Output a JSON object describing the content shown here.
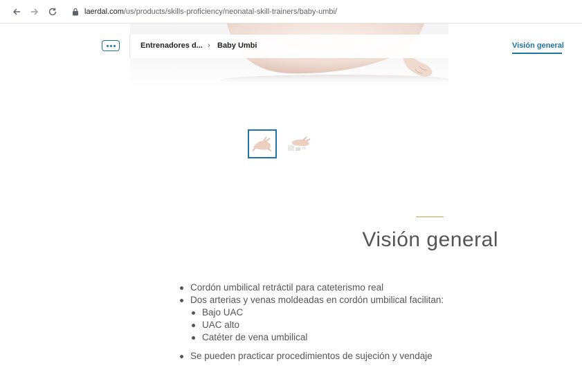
{
  "browser": {
    "url_host": "laerdal.com",
    "url_path": "/us/products/skills-proficiency/neonatal-skill-trainers/baby-umbi/"
  },
  "subnav": {
    "breadcrumb_1": "Entrenadores d...",
    "breadcrumb_sep": "›",
    "breadcrumb_2": "Baby Umbi",
    "overview_link": "Visión general"
  },
  "thumbnails": [
    {
      "name": "thumbnail-1",
      "selected": true
    },
    {
      "name": "thumbnail-2",
      "selected": false
    }
  ],
  "overview": {
    "title": "Visión general",
    "bullets": [
      "Cordón umbilical retráctil para cateterismo real",
      "Dos arterias y venas moldeadas en cordón umbilical facilitan:"
    ],
    "sub_bullets": [
      "Bajo UAC",
      "UAC alto",
      "Catéter de vena umbilical"
    ],
    "bullet_after": "Se pueden practicar procedimientos de sujeción y vendaje"
  },
  "colors": {
    "accent_blue": "#1f74a6",
    "accent_gold": "#c9a24a"
  },
  "icons": [
    "back-arrow-icon",
    "forward-arrow-icon",
    "reload-icon",
    "lock-icon",
    "more-dots-icon"
  ]
}
